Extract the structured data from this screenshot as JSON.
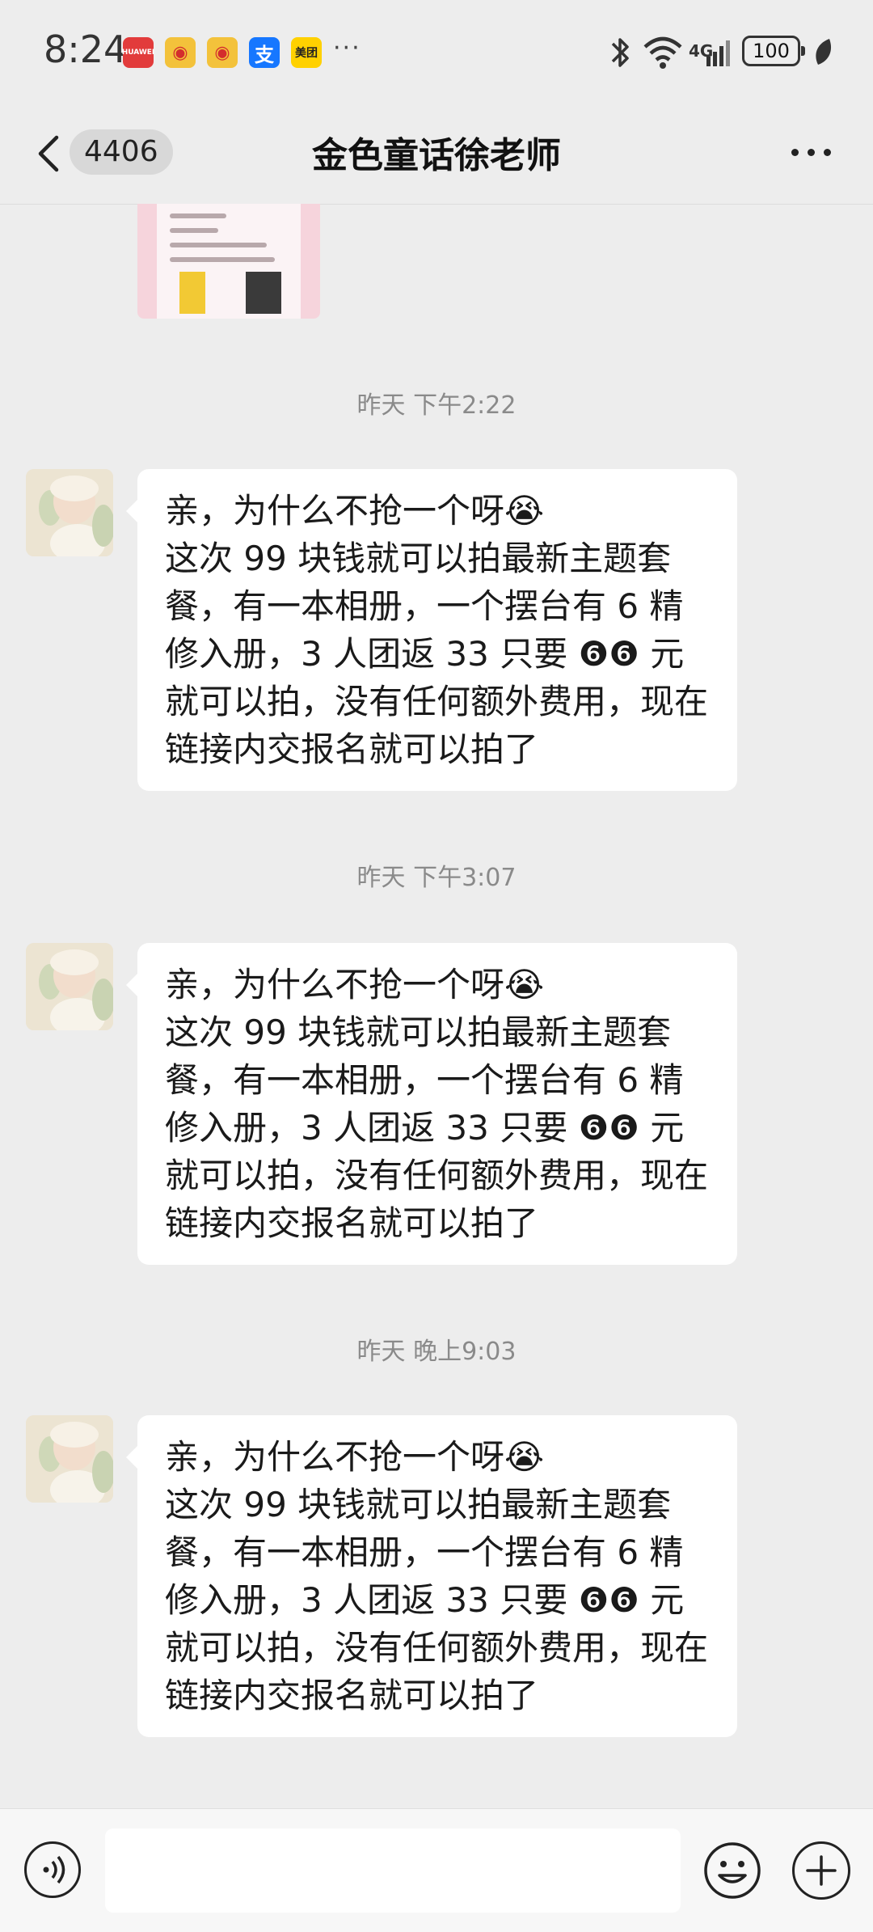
{
  "status_bar": {
    "time": "8:24",
    "notifications": [
      "huawei-icon",
      "weibo-icon",
      "weibo-icon",
      "alipay-icon",
      "meituan-icon"
    ],
    "notif_more": "···",
    "network": "4G",
    "battery": "100",
    "icons": [
      "bluetooth-icon",
      "wifi-icon",
      "signal-icon",
      "battery-icon",
      "leaf-icon"
    ]
  },
  "header": {
    "unread_count": "4406",
    "title": "金色童话徐老师"
  },
  "messages": [
    {
      "timestamp": "昨天 下午2:22",
      "text": "亲，为什么不抢一个呀😭\n这次 99 块钱就可以拍最新主题套餐，有一本相册，一个摆台有 6 精修入册，3 人团返 33 只要 ❻❻ 元就可以拍，没有任何额外费用，现在链接内交报名就可以拍了"
    },
    {
      "timestamp": "昨天 下午3:07",
      "text": "亲，为什么不抢一个呀😭\n这次 99 块钱就可以拍最新主题套餐，有一本相册，一个摆台有 6 精修入册，3 人团返 33 只要 ❻❻ 元就可以拍，没有任何额外费用，现在链接内交报名就可以拍了"
    },
    {
      "timestamp": "昨天 晚上9:03",
      "text": "亲，为什么不抢一个呀😭\n这次 99 块钱就可以拍最新主题套餐，有一本相册，一个摆台有 6 精修入册，3 人团返 33 只要 ❻❻ 元就可以拍，没有任何额外费用，现在链接内交报名就可以拍了"
    }
  ],
  "input_bar": {
    "value": "",
    "icons": [
      "voice-icon",
      "emoji-icon",
      "plus-icon"
    ]
  }
}
